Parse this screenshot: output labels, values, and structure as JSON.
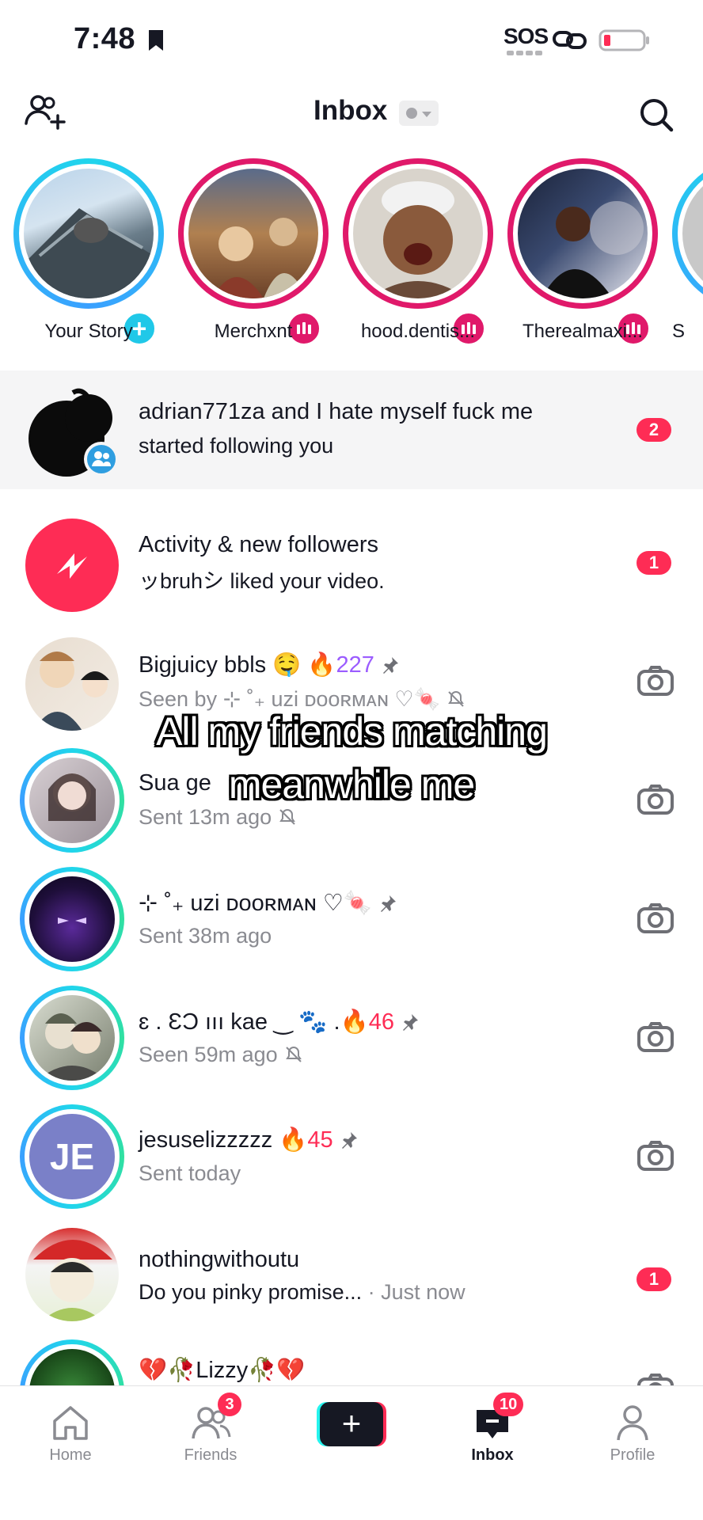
{
  "status_bar": {
    "time": "7:48",
    "sos": "SOS"
  },
  "header": {
    "title": "Inbox"
  },
  "stories": [
    {
      "name": "Your Story"
    },
    {
      "name": "Merchxnt"
    },
    {
      "name": "hood.dentis..."
    },
    {
      "name": "Therealmaxi..."
    },
    {
      "name": "S"
    }
  ],
  "notifications": [
    {
      "title": "adrian771za and I hate myself fuck me",
      "subtitle": "started following you",
      "count": "2"
    },
    {
      "title": "Activity & new followers",
      "subtitle": "ッbruhシ liked your video.",
      "count": "1"
    }
  ],
  "chats": [
    {
      "name": "Bigjuicy bbls 🤤",
      "streak": "🔥227",
      "status": "Seen by ⊹ ˚₊ uzi ᴅᴏᴏʀᴍᴀɴ ♡🍬",
      "muted": true,
      "pinned": true
    },
    {
      "name": "Sua ge",
      "status": "Sent 13m ago",
      "muted": true
    },
    {
      "name": "⊹ ˚₊ uzi ᴅᴏᴏʀᴍᴀɴ ♡🍬",
      "status": "Sent 38m ago",
      "pinned": true
    },
    {
      "name": "ɛ .   ƐƆ ııı  kae ‿ 🐾 .",
      "streak": "🔥46",
      "status": "Seen 59m ago",
      "muted": true,
      "pinned": true
    },
    {
      "name": "jesuselizzzzz",
      "streak": "🔥45",
      "status": "Sent today",
      "initials": "JE",
      "pinned": true
    },
    {
      "name": "nothingwithoutu",
      "message": "Do you pinky promise...",
      "time": " · Just now",
      "count": "1"
    },
    {
      "name": "💔🥀Lizzy🥀💔"
    }
  ],
  "caption": {
    "line1": "All my friends matching",
    "line2": "meanwhile me"
  },
  "bottom_nav": {
    "home": "Home",
    "friends": "Friends",
    "friends_badge": "3",
    "create": "+",
    "inbox": "Inbox",
    "inbox_badge": "10",
    "profile": "Profile"
  },
  "colors": {
    "accent": "#fe2c55",
    "story_pink": "#e0196a",
    "ring_cyan": "#20d5ec",
    "text": "#161823",
    "muted": "#8a8b91"
  }
}
